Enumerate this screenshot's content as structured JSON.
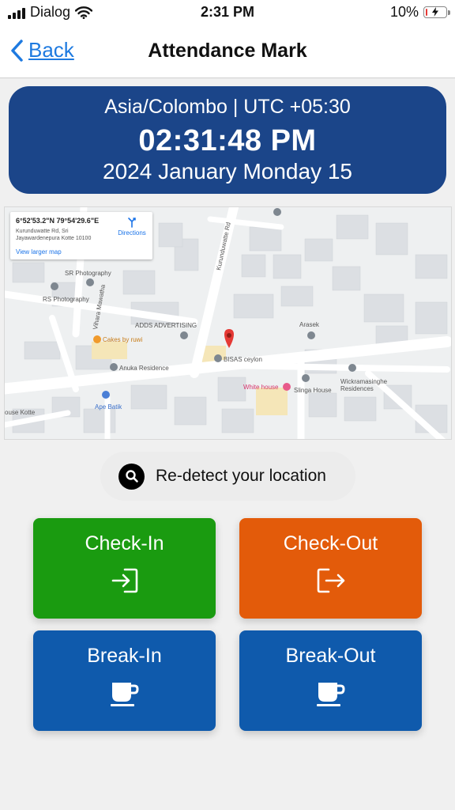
{
  "status_bar": {
    "carrier": "Dialog",
    "time": "2:31 PM",
    "battery": "10%",
    "battery_level": 0.1
  },
  "nav": {
    "back_label": "Back",
    "title": "Attendance Mark"
  },
  "time_card": {
    "timezone": "Asia/Colombo | UTC +05:30",
    "clock": "02:31:48 PM",
    "date": "2024 January Monday 15"
  },
  "map": {
    "coords": "6°52'53.2\"N 79°54'29.6\"E",
    "address": "Kurunduwatte Rd, Sri Jayawardenepura Kotte 10100",
    "view_larger": "View larger map",
    "directions": "Directions",
    "places": {
      "sr_photography": "SR Photography",
      "rs_photography": "RS Photography",
      "vihara_mawatha": "Vihara Mawatha",
      "kurunduwatte_rd": "Kurunduwatte Rd",
      "adds_advertising": "ADDS ADVERTISING",
      "cakes_by_ruwi": "Cakes by ruwi",
      "anuka_residence": "Anuka Residence",
      "bisas_ceylon": "BISAS ceylon",
      "arasek": "Arasek",
      "wickramasinghe_residences": "Wickramasinghe Residences",
      "white_house": "White house",
      "slinga_house": "Slinga House",
      "ape_batik": "Ape Batik",
      "house_kotte": "ouse Kotte"
    }
  },
  "redetect": {
    "label": "Re-detect your location",
    "icon": "search-icon"
  },
  "actions": {
    "check_in": {
      "label": "Check-In",
      "icon": "login-icon",
      "color": "#1a9b10"
    },
    "check_out": {
      "label": "Check-Out",
      "icon": "logout-icon",
      "color": "#e35b0a"
    },
    "break_in": {
      "label": "Break-In",
      "icon": "coffee-cup-icon",
      "color": "#0f5aac"
    },
    "break_out": {
      "label": "Break-Out",
      "icon": "coffee-cup-icon",
      "color": "#0f5aac"
    }
  },
  "colors": {
    "time_card_bg": "#1b4589",
    "link": "#1e7ae0",
    "map_pin": "#e53935"
  }
}
